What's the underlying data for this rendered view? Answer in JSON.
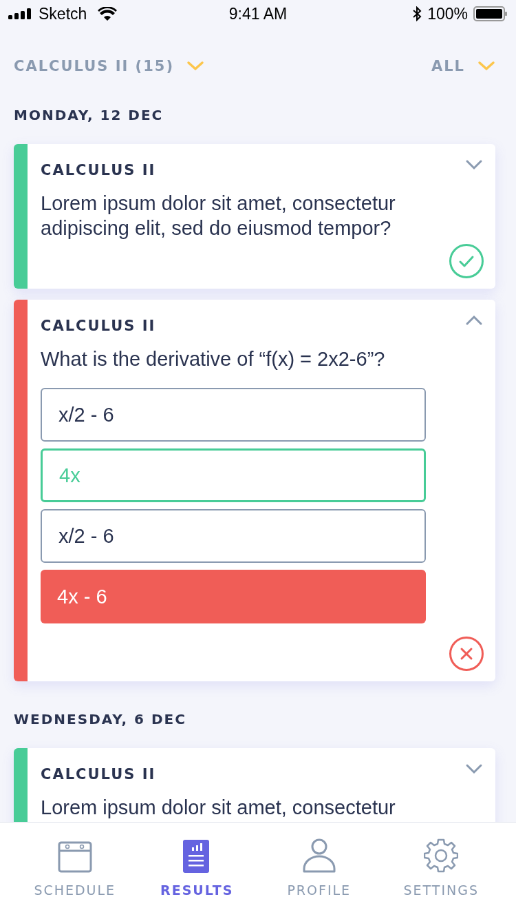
{
  "status_bar": {
    "carrier": "Sketch",
    "time": "9:41 AM",
    "battery": "100%"
  },
  "filters": [
    {
      "label": "CALCULUS II (15)"
    },
    {
      "label": "ALL"
    }
  ],
  "sections": [
    {
      "date": "MONDAY, 12 DEC",
      "cards": [
        {
          "course": "CALCULUS II",
          "question": "Lorem ipsum dolor sit amet, consectetur adipiscing elit, sed do eiusmod tempor?",
          "correct": true,
          "expanded": false
        },
        {
          "course": "CALCULUS II",
          "question": "What is the derivative of “f(x) = 2x2-6”?",
          "correct": false,
          "expanded": true,
          "options": [
            {
              "label": "x/2 - 6",
              "kind": "plain"
            },
            {
              "label": "4x",
              "kind": "correct"
            },
            {
              "label": "x/2 - 6",
              "kind": "plain"
            },
            {
              "label": "4x - 6",
              "kind": "wrong"
            }
          ]
        }
      ]
    },
    {
      "date": "WEDNESDAY, 6 DEC",
      "cards": [
        {
          "course": "CALCULUS II",
          "question": "Lorem ipsum dolor sit amet, consectetur",
          "correct": true,
          "expanded": false
        }
      ]
    }
  ],
  "tabs": [
    {
      "label": "SCHEDULE",
      "selected": false
    },
    {
      "label": "RESULTS",
      "selected": true
    },
    {
      "label": "PROFILE",
      "selected": false
    },
    {
      "label": "SETTINGS",
      "selected": false
    }
  ]
}
